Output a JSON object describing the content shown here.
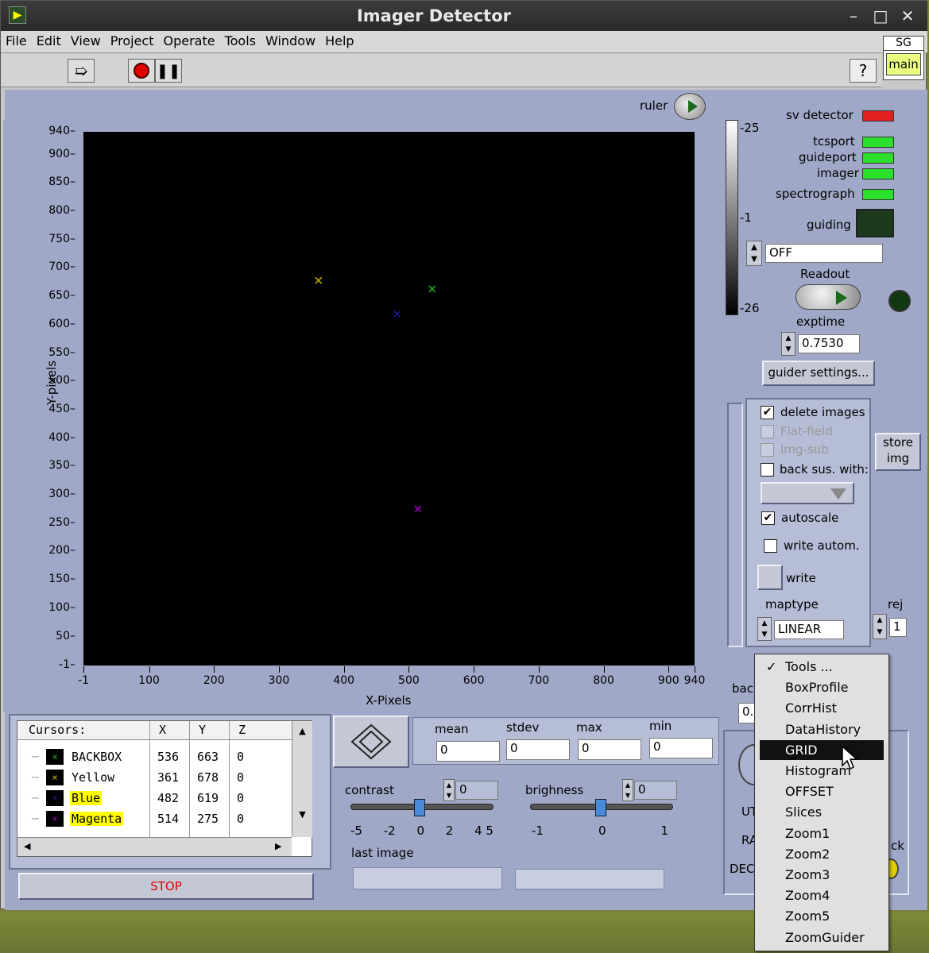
{
  "window": {
    "title": "Imager Detector",
    "minimize": "–",
    "maximize": "□",
    "close": "✕"
  },
  "menu": [
    "File",
    "Edit",
    "View",
    "Project",
    "Operate",
    "Tools",
    "Window",
    "Help"
  ],
  "toolbar": {
    "help": "?",
    "sg": "SG",
    "main": "main"
  },
  "plot": {
    "ylabel": "Y-pixels",
    "xlabel": "X-Pixels",
    "yticks": [
      "940",
      "900",
      "850",
      "800",
      "750",
      "700",
      "650",
      "600",
      "550",
      "500",
      "450",
      "400",
      "350",
      "300",
      "250",
      "200",
      "150",
      "100",
      "50",
      "-1"
    ],
    "xticks": [
      "-1",
      "100",
      "200",
      "300",
      "400",
      "500",
      "600",
      "700",
      "800",
      "900",
      "940"
    ],
    "markers": [
      {
        "name": "Yellow",
        "x": 361,
        "y": 678,
        "color": "#c8b400"
      },
      {
        "name": "BACKBOX",
        "x": 536,
        "y": 663,
        "color": "#20b020"
      },
      {
        "name": "Blue",
        "x": 482,
        "y": 619,
        "color": "#1a1aa0"
      },
      {
        "name": "Magenta",
        "x": 514,
        "y": 275,
        "color": "#a000c0"
      }
    ]
  },
  "ruler_label": "ruler",
  "colorbar": {
    "top": "-25",
    "mid": "-1",
    "bottom": "-26"
  },
  "status": {
    "sv_detector": "sv detector",
    "tcsport": "tcsport",
    "guideport": "guideport",
    "imager": "imager",
    "spectrograph": "spectrograph",
    "guiding": "guiding",
    "guiding_value": "OFF",
    "readout": "Readout",
    "exptime": "exptime",
    "exptime_value": "0.7530",
    "guider_settings": "guider settings..."
  },
  "options": {
    "delete_images": "delete images",
    "flat_field": "Flat-field",
    "img_sub": "Img-sub",
    "back_sus": "back sus. with:",
    "autoscale": "autoscale",
    "write_autom": "write autom.",
    "write": "write",
    "maptype": "maptype",
    "maptype_value": "LINEAR",
    "rej": "rej",
    "rej_value": "1",
    "store_img_1": "store",
    "store_img_2": "img"
  },
  "cursors": {
    "headers": [
      "Cursors:",
      "X",
      "Y",
      "Z"
    ],
    "rows": [
      {
        "name": "BACKBOX",
        "x": "536",
        "y": "663",
        "z": "0",
        "mark": "#20b020",
        "hl": false
      },
      {
        "name": "Yellow",
        "x": "361",
        "y": "678",
        "z": "0",
        "mark": "#c8b400",
        "hl": false
      },
      {
        "name": "Blue",
        "x": "482",
        "y": "619",
        "z": "0",
        "mark": "#1a1aa0",
        "hl": true
      },
      {
        "name": "Magenta",
        "x": "514",
        "y": "275",
        "z": "0",
        "mark": "#a000c0",
        "hl": true
      }
    ]
  },
  "stats": {
    "mean": "mean",
    "stdev": "stdev",
    "max": "max",
    "min": "min",
    "mean_v": "0",
    "stdev_v": "0",
    "max_v": "0",
    "min_v": "0"
  },
  "contrast": {
    "label": "contrast",
    "value": "0",
    "ticks": [
      "-5",
      "-2",
      "0",
      "2",
      "4 5"
    ]
  },
  "brightness": {
    "label": "brighness",
    "value": "0",
    "ticks": [
      "-1",
      "0",
      "1"
    ]
  },
  "last_image": "last image",
  "stop": "STOP",
  "partial": {
    "back": "bac",
    "zero": "0.",
    "ut": "UT",
    "ra": "RA",
    "dec": "DEC",
    "ack": "ck"
  },
  "dropdown": [
    "Tools ...",
    "BoxProfile",
    "CorrHist",
    "DataHistory",
    "GRID",
    "Histogram",
    "OFFSET",
    "Slices",
    "Zoom1",
    "Zoom2",
    "Zoom3",
    "Zoom4",
    "Zoom5",
    "ZoomGuider"
  ],
  "dropdown_checked": "✓",
  "colors": {
    "panel": "#9fa8c7",
    "led_red": "#e02020",
    "led_green": "#2be02b",
    "stop": "#e00000"
  }
}
